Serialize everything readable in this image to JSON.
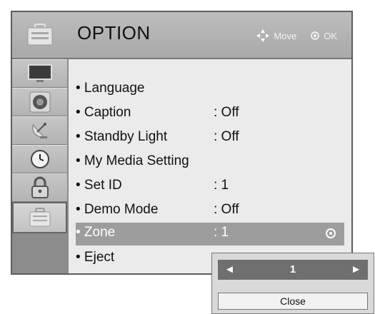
{
  "header": {
    "title": "OPTION",
    "hints": {
      "move": "Move",
      "ok": "OK"
    }
  },
  "sidebar": {
    "items": [
      {
        "icon": "picture-icon"
      },
      {
        "icon": "audio-icon"
      },
      {
        "icon": "satellite-dish-icon"
      },
      {
        "icon": "clock-icon"
      },
      {
        "icon": "lock-icon"
      },
      {
        "icon": "option-briefcase-icon",
        "active": true
      }
    ]
  },
  "menu": {
    "items": [
      {
        "label": "• Language",
        "value": ""
      },
      {
        "label": "• Caption",
        "value": ": Off"
      },
      {
        "label": "• Standby Light",
        "value": ": Off"
      },
      {
        "label": "• My Media Setting",
        "value": ""
      },
      {
        "label": "• Set ID",
        "value": ": 1"
      },
      {
        "label": "• Demo Mode",
        "value": ": Off"
      },
      {
        "label": "• Zone",
        "value": ": 1",
        "selected": true
      },
      {
        "label": "• Eject",
        "value": ""
      }
    ]
  },
  "popup": {
    "stepper_value": "1",
    "left_arrow": "◄",
    "right_arrow": "►",
    "close_label": "Close"
  },
  "colors": {
    "frame": "#8c8c8c",
    "panel": "#ebebeb",
    "selection": "#9d9d9d",
    "stepper": "#6f6f6f"
  }
}
